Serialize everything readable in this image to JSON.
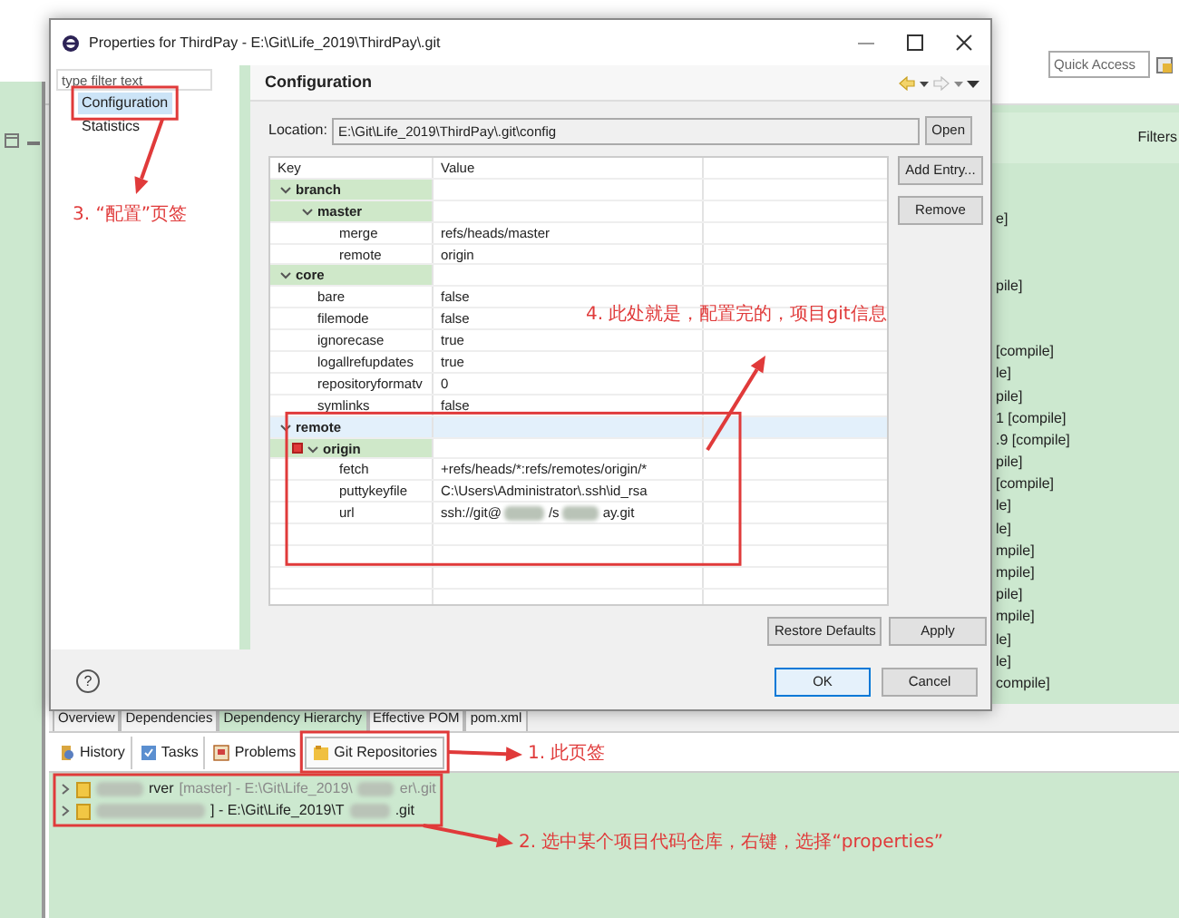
{
  "ide": {
    "quick_access": {
      "placeholder": "Quick Access"
    },
    "dependency_panel": {
      "filters_label": "Filters",
      "items": [
        "e]",
        "pile]",
        "[compile]",
        "le]",
        "pile]",
        "1 [compile]",
        ".9 [compile]",
        "pile]",
        "[compile]",
        "le]",
        "le]",
        "mpile]",
        "mpile]",
        "pile]",
        "mpile]",
        "le]",
        "le]",
        "compile]"
      ]
    },
    "editor_tabs": [
      {
        "label": "Overview",
        "selected": false
      },
      {
        "label": "Dependencies",
        "selected": false
      },
      {
        "label": "Dependency Hierarchy",
        "selected": true
      },
      {
        "label": "Effective POM",
        "selected": false
      },
      {
        "label": "pom.xml",
        "selected": false
      }
    ],
    "view_tabs": [
      {
        "label": "History",
        "kind": "history",
        "selected": false
      },
      {
        "label": "Tasks",
        "kind": "tasks",
        "selected": false
      },
      {
        "label": "Problems",
        "kind": "problems",
        "selected": false
      },
      {
        "label": "Git Repositories",
        "kind": "git",
        "selected": true
      }
    ],
    "repositories": [
      {
        "name_tail": "rver",
        "path": "[master] - E:\\Git\\Life_2019\\",
        "tail": "er\\.git",
        "dimmed": true
      },
      {
        "path": "] - E:\\Git\\Life_2019\\T",
        "tail": ".git",
        "dimmed": false
      }
    ]
  },
  "dialog": {
    "title": "Properties for ThirdPay - E:\\Git\\Life_2019\\ThirdPay\\.git",
    "filter": {
      "placeholder": "type filter text"
    },
    "pages": [
      {
        "label": "Configuration",
        "selected": true
      },
      {
        "label": "Statistics",
        "selected": false
      }
    ],
    "page_title": "Configuration",
    "location": {
      "label": "Location:",
      "value": "E:\\Git\\Life_2019\\ThirdPay\\.git\\config"
    },
    "open_button": "Open",
    "columns": [
      "Key",
      "Value"
    ],
    "entries": [
      {
        "key": "branch",
        "kind": "section",
        "expanded": true,
        "selected": false,
        "children": [
          {
            "key": "master",
            "kind": "section",
            "expanded": true,
            "selected": false,
            "children": [
              {
                "key": "merge",
                "value": "refs/heads/master",
                "kind": "entry",
                "selected": false
              },
              {
                "key": "remote",
                "value": "origin",
                "kind": "entry",
                "selected": false
              }
            ]
          }
        ]
      },
      {
        "key": "core",
        "kind": "section",
        "expanded": true,
        "selected": false,
        "children": [
          {
            "key": "bare",
            "value": "false",
            "kind": "entry",
            "selected": false
          },
          {
            "key": "filemode",
            "value": "false",
            "kind": "entry",
            "selected": false
          },
          {
            "key": "ignorecase",
            "value": "true",
            "kind": "entry",
            "selected": false
          },
          {
            "key": "logallrefupdates",
            "value": "true",
            "kind": "entry",
            "selected": false
          },
          {
            "key": "repositoryformatv",
            "value": "0",
            "kind": "entry",
            "selected": false
          },
          {
            "key": "symlinks",
            "value": "false",
            "kind": "entry",
            "selected": false
          }
        ]
      },
      {
        "key": "remote",
        "kind": "section",
        "expanded": true,
        "selected": true,
        "children": [
          {
            "key": "origin",
            "kind": "section",
            "expanded": true,
            "selected": false,
            "flagged": true,
            "children": [
              {
                "key": "fetch",
                "value": "+refs/heads/*:refs/remotes/origin/*",
                "kind": "entry",
                "selected": false
              },
              {
                "key": "puttykeyfile",
                "value": "C:\\Users\\Administrator\\.ssh\\id_rsa",
                "kind": "entry",
                "selected": false
              },
              {
                "key": "url",
                "value_parts": [
                  "ssh://git@",
                  "/s",
                  "ay.git"
                ],
                "kind": "entry",
                "selected": false
              }
            ]
          }
        ]
      }
    ],
    "side_buttons": [
      "Add Entry...",
      "Remove"
    ],
    "lower_buttons": [
      "Restore Defaults",
      "Apply"
    ],
    "help": "?",
    "buttons": [
      {
        "label": "OK",
        "default": true
      },
      {
        "label": "Cancel",
        "default": false
      }
    ]
  },
  "annotations": [
    {
      "text": "3. “配置”页签"
    },
    {
      "text": "4. 此处就是，配置完的，项目git信息"
    },
    {
      "text": "1. 此页签"
    },
    {
      "text": "2. 选中某个项目代码仓库，右键，选择“properties”"
    }
  ]
}
